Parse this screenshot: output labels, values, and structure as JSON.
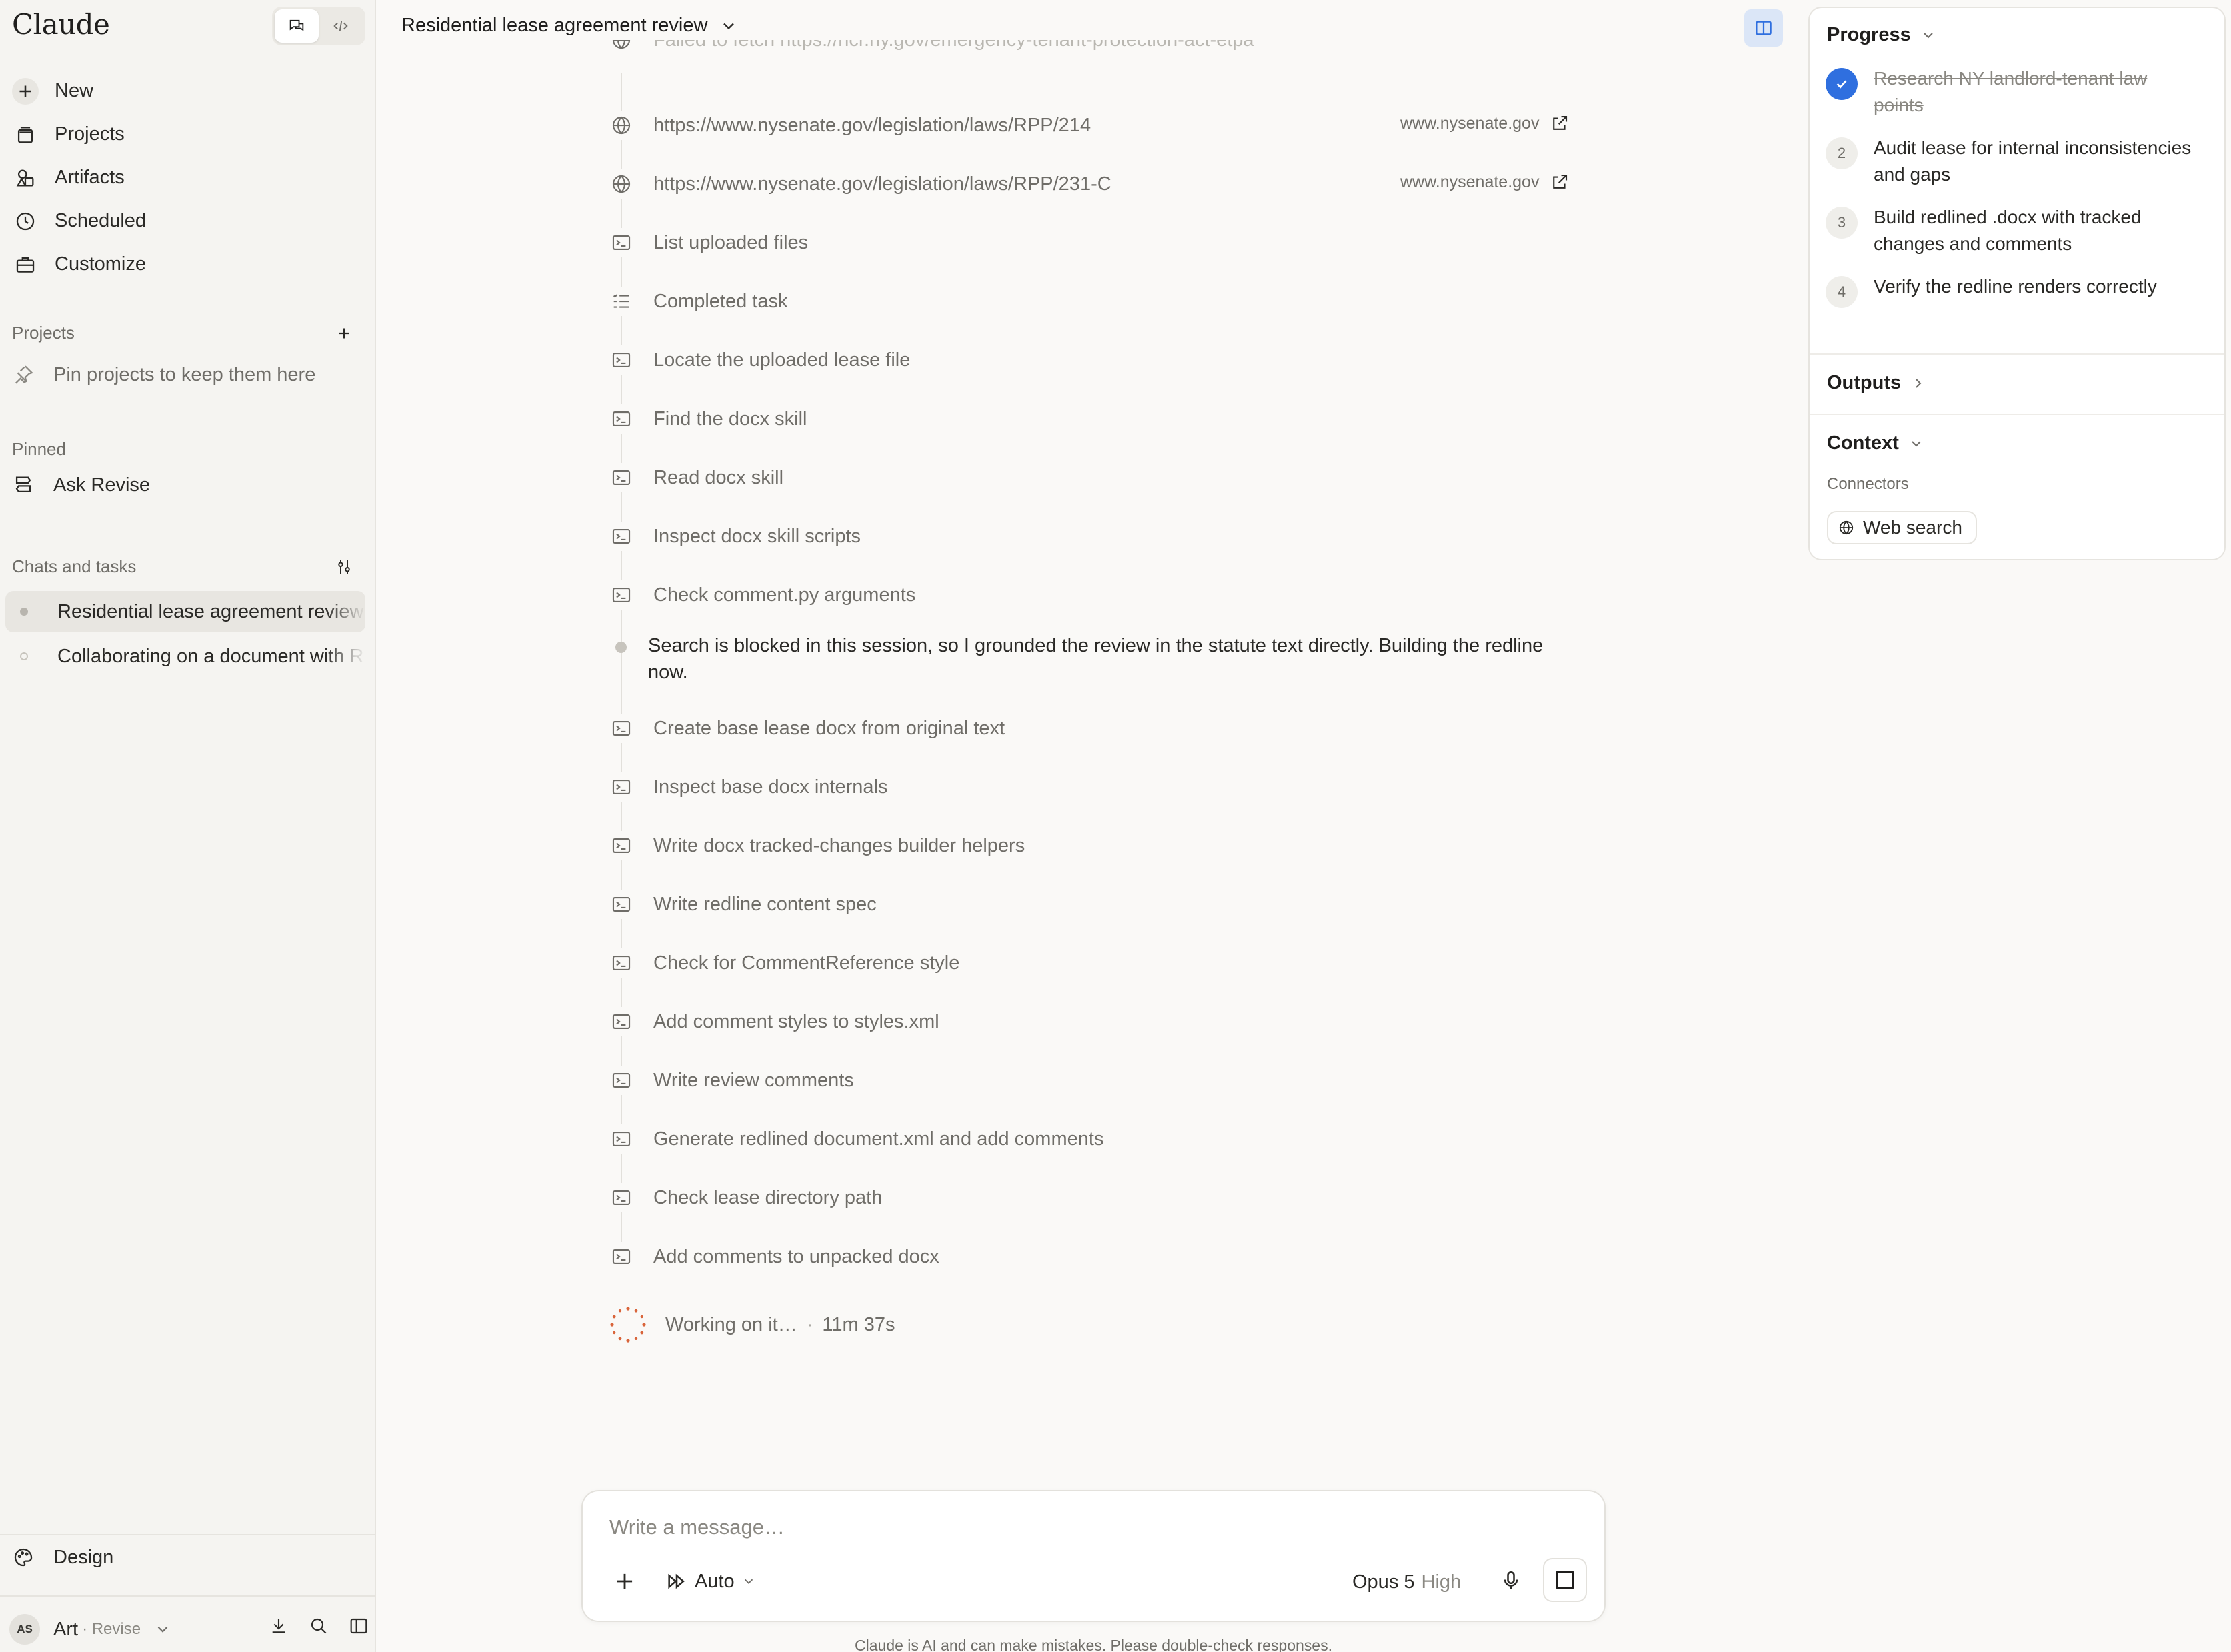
{
  "sidebar": {
    "brand": "Claude",
    "nav": [
      {
        "label": "New",
        "icon": "plus-icon"
      },
      {
        "label": "Projects",
        "icon": "projects-icon"
      },
      {
        "label": "Artifacts",
        "icon": "artifacts-icon"
      },
      {
        "label": "Scheduled",
        "icon": "clock-icon"
      },
      {
        "label": "Customize",
        "icon": "briefcase-icon"
      }
    ],
    "projects_label": "Projects",
    "pin_hint": "Pin projects to keep them here",
    "pinned_label": "Pinned",
    "pinned_items": [
      {
        "label": "Ask Revise"
      }
    ],
    "chats_label": "Chats and tasks",
    "chats": [
      {
        "label": "Residential lease agreement review",
        "active": true
      },
      {
        "label": "Collaborating on a document with R",
        "active": false
      }
    ],
    "design_label": "Design",
    "user": {
      "initials": "AS",
      "name": "Art",
      "org": "· Revise"
    }
  },
  "header": {
    "title": "Residential lease agreement review"
  },
  "timeline": {
    "items": [
      {
        "text": "Failed to fetch https://hcr.ny.gov/emergency-tenant-protection-act-etpa",
        "icon": "globe-icon",
        "faded": true
      },
      {
        "text": "https://www.nysenate.gov/legislation/laws/RPP/214",
        "icon": "globe-icon",
        "source": "www.nysenate.gov"
      },
      {
        "text": "https://www.nysenate.gov/legislation/laws/RPP/231-C",
        "icon": "globe-icon",
        "source": "www.nysenate.gov"
      },
      {
        "text": "List uploaded files",
        "icon": "terminal-icon"
      },
      {
        "text": "Completed task",
        "icon": "checklist-icon"
      },
      {
        "text": "Locate the uploaded lease file",
        "icon": "terminal-icon"
      },
      {
        "text": "Find the docx skill",
        "icon": "terminal-icon"
      },
      {
        "text": "Read docx skill",
        "icon": "terminal-icon"
      },
      {
        "text": "Inspect docx skill scripts",
        "icon": "terminal-icon"
      },
      {
        "text": "Check comment.py arguments",
        "icon": "terminal-icon"
      },
      {
        "text": "Create base lease docx from original text",
        "icon": "terminal-icon"
      },
      {
        "text": "Inspect base docx internals",
        "icon": "terminal-icon"
      },
      {
        "text": "Write docx tracked-changes builder helpers",
        "icon": "terminal-icon"
      },
      {
        "text": "Write redline content spec",
        "icon": "terminal-icon"
      },
      {
        "text": "Check for CommentReference style",
        "icon": "terminal-icon"
      },
      {
        "text": "Add comment styles to styles.xml",
        "icon": "terminal-icon"
      },
      {
        "text": "Write review comments",
        "icon": "terminal-icon"
      },
      {
        "text": "Generate redlined document.xml and add comments",
        "icon": "terminal-icon"
      },
      {
        "text": "Check lease directory path",
        "icon": "terminal-icon"
      },
      {
        "text": "Add comments to unpacked docx",
        "icon": "terminal-icon"
      }
    ],
    "note": "Search is blocked in this session, so I grounded the review in the statute text directly. Building the redline now.",
    "working_text": "Working on it…",
    "elapsed": "11m 37s"
  },
  "composer": {
    "placeholder": "Write a message…",
    "mode": "Auto",
    "model": "Opus 5",
    "effort": "High",
    "disclaimer": "Claude is AI and can make mistakes. Please double-check responses."
  },
  "panel": {
    "progress_label": "Progress",
    "steps": [
      {
        "num": "1",
        "text": "Research NY landlord-tenant law points",
        "done": true
      },
      {
        "num": "2",
        "text": "Audit lease for internal inconsistencies and gaps",
        "done": false
      },
      {
        "num": "3",
        "text": "Build redlined .docx with tracked changes and comments",
        "done": false
      },
      {
        "num": "4",
        "text": "Verify the redline renders correctly",
        "done": false
      }
    ],
    "outputs_label": "Outputs",
    "context_label": "Context",
    "connectors_label": "Connectors",
    "connector": "Web search"
  },
  "colors": {
    "accent": "#2f6fdf",
    "spinner": "#d9653b",
    "panel_toggle_bg": "#dbe6f7"
  }
}
